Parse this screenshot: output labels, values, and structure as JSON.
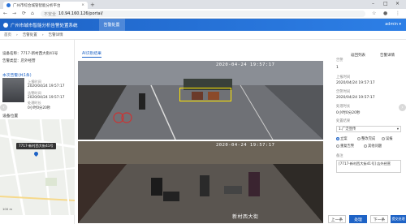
{
  "browser": {
    "tab_title": "广州市综合城管智能分析平台",
    "url": "10.94.160.126/portal/",
    "url_prefix": "不安全"
  },
  "app": {
    "title": "广州市城市智能分析告警处置系统",
    "active_tab": "告警处置",
    "user": "admin ▾"
  },
  "breadcrumb": [
    "首页",
    "告警处置",
    "告警详情"
  ],
  "left": {
    "device_line1": "设备名称：7717-新村西大街41号",
    "device_line2": "告警类型：店外经营",
    "section_title": "本次告警(共1条)",
    "fields": [
      {
        "label": "上报时间",
        "value": "2020/04/24 19:57:17"
      },
      {
        "label": "告警时间",
        "value": "2020/04/24 19:57:17"
      },
      {
        "label": "处理时长",
        "value": "0小时0分20秒"
      }
    ],
    "map_header": "设备位置",
    "map_label": "7717-新村西大街41号",
    "map_scale": "100 m"
  },
  "center": {
    "tab": "AI识别结果",
    "osd_top": "2020-04-24  19:57:17",
    "osd_bottom": "2020-04-24  19:57:17",
    "cam_name": "新村西大街",
    "box_label": "店外经营"
  },
  "right": {
    "top_actions": [
      "返回列表",
      "告警详情"
    ],
    "fields": [
      {
        "label": "告警",
        "value": "1"
      },
      {
        "label": "上报时间",
        "value": "2020/04/24 19:57:17"
      },
      {
        "label": "告警时间",
        "value": "2020/04/24 19:57:17"
      },
      {
        "label": "处理时长",
        "value": "0小时0分20秒"
      }
    ],
    "disposal_label": "处置结果",
    "disposal_value": "1.广泛宣传",
    "radios": [
      "立案",
      "整改完成",
      "误报",
      "重复告警",
      "其他问题"
    ],
    "note_label": "备注",
    "note_value": "[7717-新村西大街41号] 店外经营",
    "selected_radio": 0
  },
  "footer": {
    "buttons": [
      "上一条",
      "处理",
      "下一条",
      "提交处理"
    ]
  }
}
